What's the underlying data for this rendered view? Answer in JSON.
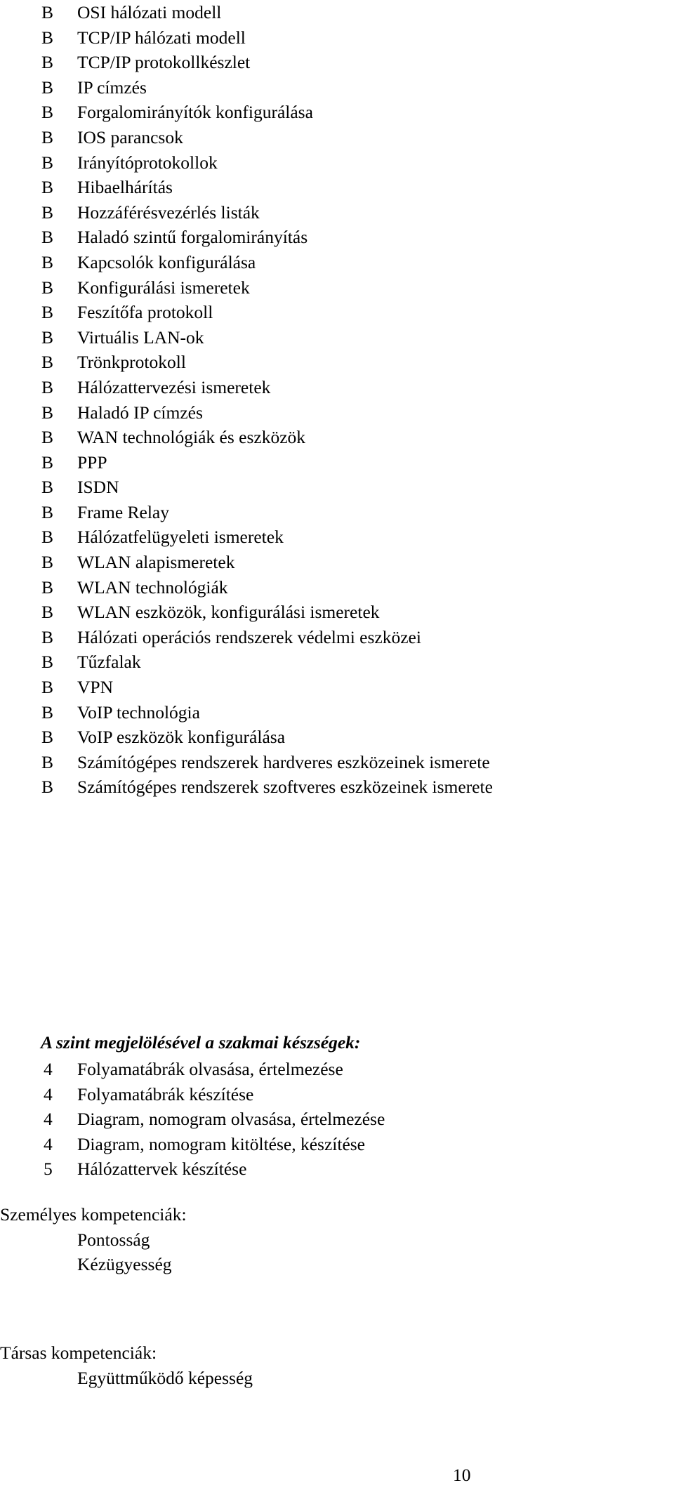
{
  "document": {
    "page_number": "10"
  },
  "knowledge_list": {
    "level_mark": "B",
    "items": [
      "OSI hálózati modell",
      "TCP/IP hálózati modell",
      "TCP/IP protokollkészlet",
      "IP címzés",
      "Forgalomirányítók konfigurálása",
      "IOS parancsok",
      "Irányítóprotokollok",
      "Hibaelhárítás",
      "Hozzáférésvezérlés listák",
      "Haladó szintű forgalomirányítás",
      "Kapcsolók konfigurálása",
      "Konfigurálási ismeretek",
      "Feszítőfa protokoll",
      "Virtuális LAN-ok",
      "Trönkprotokoll",
      "Hálózattervezési ismeretek",
      "Haladó IP címzés",
      "WAN technológiák és eszközök",
      "PPP",
      "ISDN",
      "Frame Relay",
      "Hálózatfelügyeleti ismeretek",
      "WLAN alapismeretek",
      "WLAN technológiák",
      "WLAN eszközök, konfigurálási ismeretek",
      "Hálózati operációs rendszerek védelmi eszközei",
      "Tűzfalak",
      "VPN",
      "VoIP technológia",
      "VoIP eszközök konfigurálása",
      "Számítógépes rendszerek hardveres eszközeinek ismerete",
      "Számítógépes rendszerek szoftveres eszközeinek ismerete"
    ]
  },
  "skills_section": {
    "heading": "A szint megjelölésével a szakmai készségek:",
    "items": [
      {
        "level": "4",
        "label": "Folyamatábrák olvasása, értelmezése"
      },
      {
        "level": "4",
        "label": "Folyamatábrák készítése"
      },
      {
        "level": "4",
        "label": "Diagram, nomogram olvasása, értelmezése"
      },
      {
        "level": "4",
        "label": "Diagram, nomogram kitöltése, készítése"
      },
      {
        "level": "5",
        "label": "Hálózattervek készítése"
      }
    ]
  },
  "personal_competencies": {
    "title": "Személyes kompetenciák:",
    "items": [
      "Pontosság",
      "Kézügyesség"
    ]
  },
  "social_competencies": {
    "title": "Társas kompetenciák:",
    "items": [
      "Együttműködő képesség"
    ]
  }
}
